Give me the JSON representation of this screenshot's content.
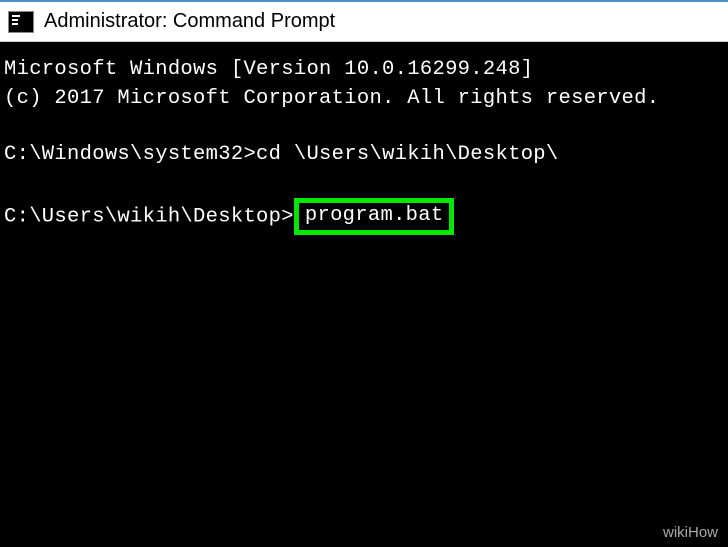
{
  "titlebar": {
    "title": "Administrator: Command Prompt"
  },
  "terminal": {
    "header_line1": "Microsoft Windows [Version 10.0.16299.248]",
    "header_line2": "(c) 2017 Microsoft Corporation. All rights reserved.",
    "prompt1": "C:\\Windows\\system32>",
    "command1": "cd \\Users\\wikih\\Desktop\\",
    "prompt2": "C:\\Users\\wikih\\Desktop>",
    "command2_highlighted": "program.bat"
  },
  "watermark": "wikiHow"
}
